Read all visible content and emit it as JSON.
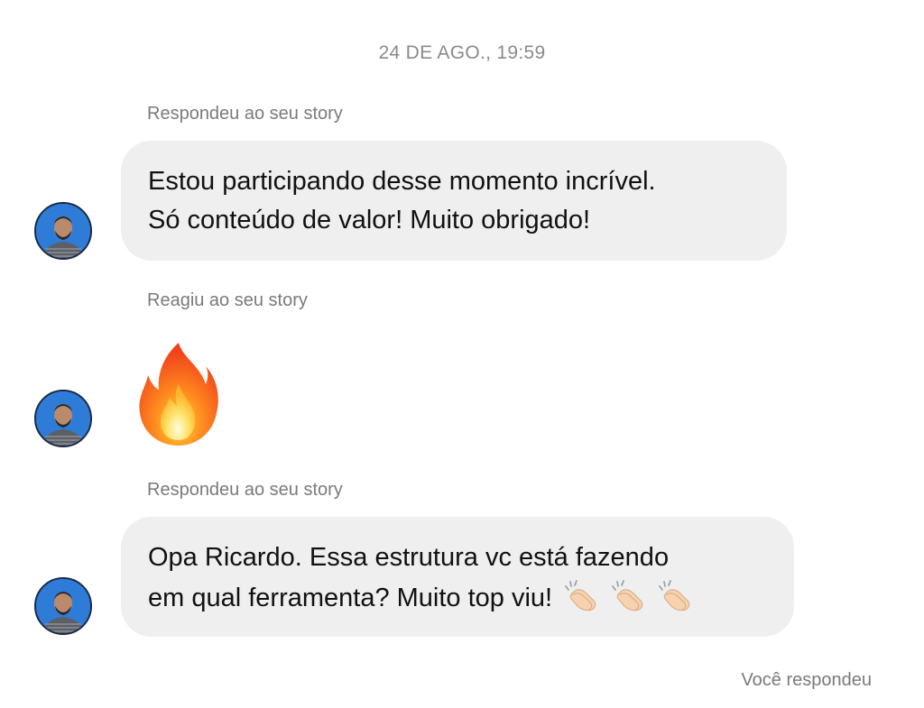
{
  "timestamp": "24 DE AGO., 19:59",
  "messages": [
    {
      "caption": "Respondeu ao seu story",
      "lines": [
        "Estou participando desse momento incrível.",
        "Só conteúdo de valor! Muito obrigado!"
      ]
    },
    {
      "caption": "Reagiu ao seu story",
      "reaction": "fire-emoji"
    },
    {
      "caption": "Respondeu ao seu story",
      "lines": [
        "Opa Ricardo. Essa estrutura vc está fazendo",
        "em qual ferramenta? Muito top viu!"
      ],
      "trailing_emoji": [
        "clapping-hands-emoji",
        "clapping-hands-emoji",
        "clapping-hands-emoji"
      ]
    }
  ],
  "footer": {
    "you_replied": "Você respondeu"
  },
  "colors": {
    "bubble": "#efefef",
    "caption": "#7a7a7e",
    "avatar_bg": "#2f7bd8"
  }
}
